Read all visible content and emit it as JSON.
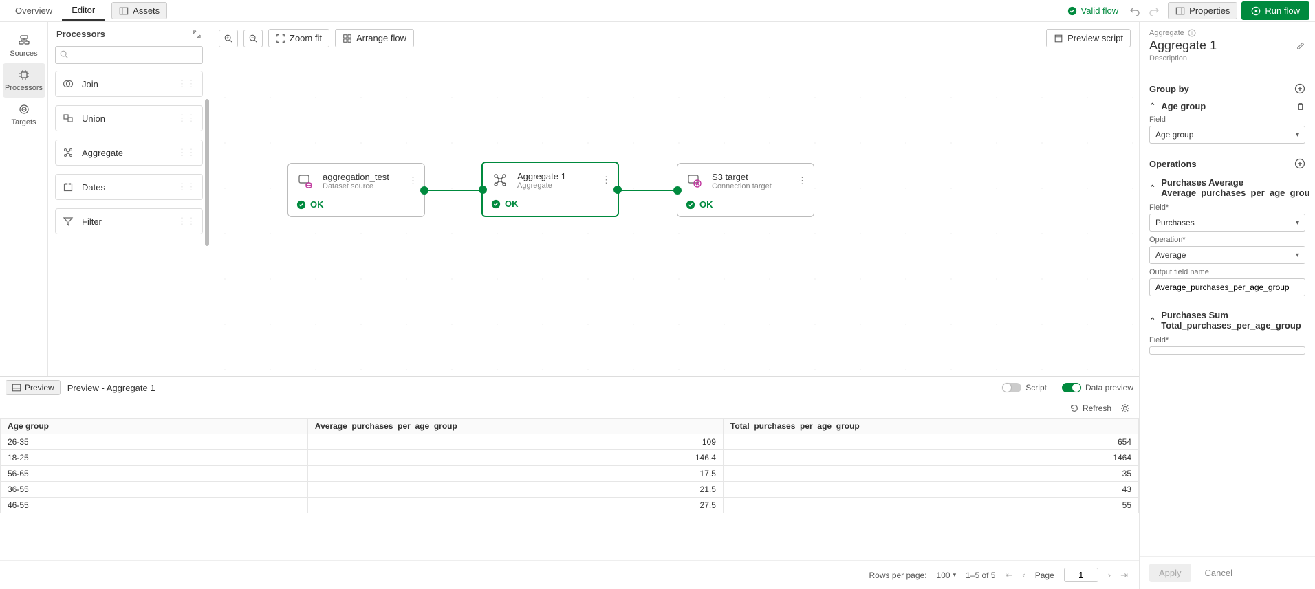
{
  "topbar": {
    "tabs": {
      "overview": "Overview",
      "editor": "Editor"
    },
    "assets": "Assets",
    "valid": "Valid flow",
    "properties": "Properties",
    "run": "Run flow"
  },
  "rail": {
    "sources": "Sources",
    "processors": "Processors",
    "targets": "Targets"
  },
  "procPanel": {
    "title": "Processors",
    "items": [
      "Join",
      "Union",
      "Aggregate",
      "Dates",
      "Filter"
    ]
  },
  "canvasToolbar": {
    "zoomfit": "Zoom fit",
    "arrange": "Arrange flow",
    "preview": "Preview script"
  },
  "nodes": {
    "a": {
      "title": "aggregation_test",
      "sub": "Dataset source",
      "status": "OK"
    },
    "b": {
      "title": "Aggregate 1",
      "sub": "Aggregate",
      "status": "OK"
    },
    "c": {
      "title": "S3 target",
      "sub": "Connection target",
      "status": "OK"
    }
  },
  "preview": {
    "button": "Preview",
    "label": "Preview - Aggregate 1",
    "scriptLabel": "Script",
    "dataLabel": "Data preview",
    "refresh": "Refresh",
    "columns": [
      "Age group",
      "Average_purchases_per_age_group",
      "Total_purchases_per_age_group"
    ],
    "rows": [
      [
        "26-35",
        "109",
        "654"
      ],
      [
        "18-25",
        "146.4",
        "1464"
      ],
      [
        "56-65",
        "17.5",
        "35"
      ],
      [
        "36-55",
        "21.5",
        "43"
      ],
      [
        "46-55",
        "27.5",
        "55"
      ]
    ],
    "pager": {
      "rowsLabel": "Rows per page:",
      "rowsValue": "100",
      "range": "1–5 of 5",
      "pageLabel": "Page",
      "pageValue": "1"
    }
  },
  "right": {
    "crumb": "Aggregate",
    "title": "Aggregate 1",
    "desc": "Description",
    "groupBy": {
      "header": "Group by",
      "item": "Age group",
      "fieldLabel": "Field",
      "fieldValue": "Age group"
    },
    "ops": {
      "header": "Operations",
      "op1": {
        "title": "Purchases Average",
        "sub": "Average_purchases_per_age_grou",
        "fieldLabel": "Field*",
        "fieldValue": "Purchases",
        "opLabel": "Operation*",
        "opValue": "Average",
        "outLabel": "Output field name",
        "outValue": "Average_purchases_per_age_group"
      },
      "op2": {
        "title": "Purchases Sum",
        "sub": "Total_purchases_per_age_group",
        "fieldLabel": "Field*"
      }
    },
    "apply": "Apply",
    "cancel": "Cancel"
  }
}
